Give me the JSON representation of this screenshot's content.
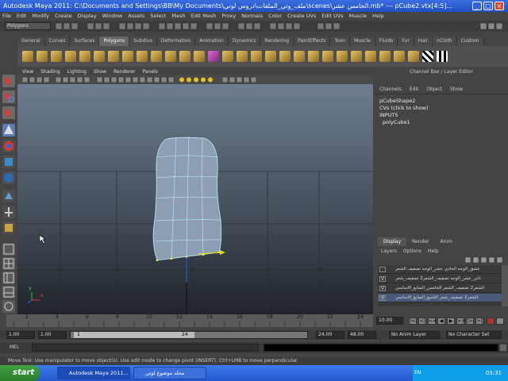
{
  "window": {
    "title": "Autodesk Maya 2011: C:\\Documents and Settings\\BB\\My Documents\\ملف_وتي_الملفات\\دروس لوتي\\scenes\\الخامس عشر.mb* --- pCube2.vtx[4:5]...",
    "minimize": "_",
    "maximize": "□",
    "close": "×"
  },
  "menubar": [
    "File",
    "Edit",
    "Modify",
    "Create",
    "Display",
    "Window",
    "Assets",
    "Select",
    "Mesh",
    "Edit Mesh",
    "Proxy",
    "Normals",
    "Color",
    "Create UVs",
    "Edit UVs",
    "Muscle",
    "Help"
  ],
  "status_line": {
    "mode": "Polygons"
  },
  "shelf": {
    "tabs": [
      "General",
      "Curves",
      "Surfaces",
      "Polygons",
      "Subdivs",
      "Deformation",
      "Animation",
      "Dynamics",
      "Rendering",
      "PaintEffects",
      "Toon",
      "Muscle",
      "Fluids",
      "Fur",
      "Hair",
      "nCloth",
      "Custom"
    ],
    "active_tab": "Polygons"
  },
  "viewport": {
    "menu": [
      "View",
      "Shading",
      "Lighting",
      "Show",
      "Renderer",
      "Panels"
    ],
    "axis_x": "x",
    "axis_y": "y"
  },
  "channel_box": {
    "title": "Channel Box / Layer Editor",
    "menu": [
      "Channels",
      "Edit",
      "Object",
      "Show"
    ],
    "object": "pCubeShape2",
    "cvs": "CVs (click to show)",
    "inputs_label": "INPUTS",
    "input_node": "polyCube1"
  },
  "layer_editor": {
    "tabs": [
      "Display",
      "Render",
      "Anim"
    ],
    "active_tab": "Display",
    "menu": [
      "Layers",
      "Options",
      "Help"
    ],
    "layers": [
      {
        "label": "عشق_الوجه الحادي عشر_الوجه تصفيف الشعر",
        "visible": ""
      },
      {
        "label": "ناتي_عشر_الوجه تصفيف_الشعر2 تصفيف_شعر",
        "visible": "V"
      },
      {
        "label": "الشعر2 تصفيف_الشعر الخامس_السابع_الاساسي",
        "visible": "V"
      },
      {
        "label": "الشعر2 تصفيف_شعر التاسع_السابع_الاساسي",
        "visible": "V"
      }
    ]
  },
  "time_slider": {
    "ticks": [
      "2",
      "4",
      "6",
      "8",
      "10",
      "12",
      "14",
      "16",
      "18",
      "20",
      "22",
      "24"
    ],
    "current": "10.00"
  },
  "range": {
    "start": "1.00",
    "start2": "1.00",
    "inner_start": "1",
    "inner_end": "24",
    "end": "24.00",
    "end2": "48.00",
    "anim_layer": "No Anim Layer",
    "char_set": "No Character Set"
  },
  "command_line": {
    "label": "MEL"
  },
  "help_line": "Move Tool: Use manipulator to move object(s). Use edit mode to change pivot (INSERT). Ctrl+LMB to move perpendicular.",
  "taskbar": {
    "start": "start",
    "tasks": [
      "Autodesk Maya 2011...",
      "مجلد موضوع لوتي"
    ],
    "lang": "EN",
    "clock": "03:31"
  }
}
